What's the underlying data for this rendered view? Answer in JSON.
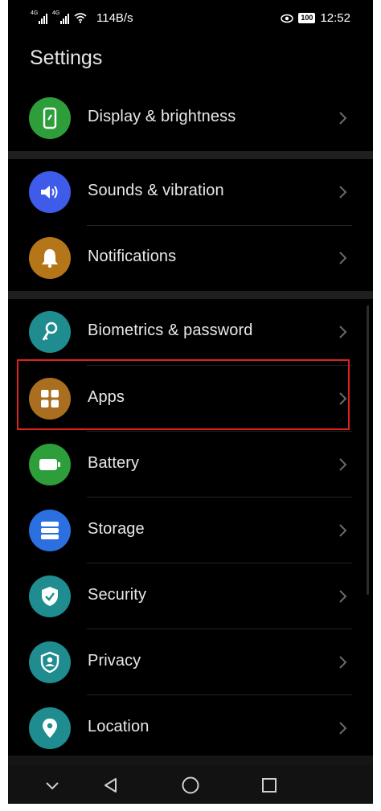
{
  "status_bar": {
    "net1": "4G",
    "net2": "4G",
    "speed": "114B/s",
    "battery": "100",
    "time": "12:52"
  },
  "title": "Settings",
  "items": [
    {
      "label": "Display & brightness",
      "icon": "display-icon",
      "color": "#2e9e3a"
    },
    {
      "label": "Sounds & vibration",
      "icon": "volume-icon",
      "color": "#3f5bea"
    },
    {
      "label": "Notifications",
      "icon": "bell-icon",
      "color": "#b5761a"
    },
    {
      "label": "Biometrics & password",
      "icon": "key-icon",
      "color": "#1f8c8f"
    },
    {
      "label": "Apps",
      "icon": "apps-grid-icon",
      "color": "#a96e1f"
    },
    {
      "label": "Battery",
      "icon": "battery-icon",
      "color": "#2e9e3a"
    },
    {
      "label": "Storage",
      "icon": "storage-icon",
      "color": "#2b6fe0"
    },
    {
      "label": "Security",
      "icon": "shield-check-icon",
      "color": "#1f8c8f"
    },
    {
      "label": "Privacy",
      "icon": "privacy-shield-icon",
      "color": "#1f8c8f"
    },
    {
      "label": "Location",
      "icon": "location-pin-icon",
      "color": "#1f8c8f"
    }
  ],
  "highlight_color": "#e0201e"
}
